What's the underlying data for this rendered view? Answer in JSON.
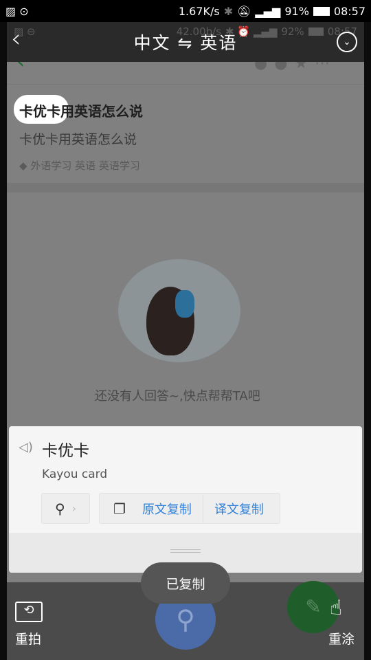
{
  "status_bar": {
    "speed": "1.67K/s",
    "battery": "91%",
    "time": "08:57"
  },
  "header": {
    "title": "中文 ⇋ 英语",
    "back_icon": "chevron-left-icon",
    "menu_icon": "chevron-down-circle-icon"
  },
  "background_page": {
    "title": "卡优卡用英语怎么说",
    "subtitle": "卡优卡用英语怎么说",
    "tags": "外语学习 英语 英语学习",
    "empty_text": "还没有人回答~,快点帮帮TA吧",
    "status_speed": "42.00b/s",
    "status_battery": "92%",
    "status_time": "08:57"
  },
  "card": {
    "source_text": "卡优卡",
    "translation": "Kayou card",
    "copy_original": "原文复制",
    "copy_translation": "译文复制"
  },
  "toast": "已复制",
  "bottom": {
    "retake": "重拍",
    "redraw": "重涂"
  },
  "colors": {
    "accent": "#2f7fd8",
    "search_fab": "#4a6aa8",
    "edit_fab": "#1f5e2a"
  }
}
